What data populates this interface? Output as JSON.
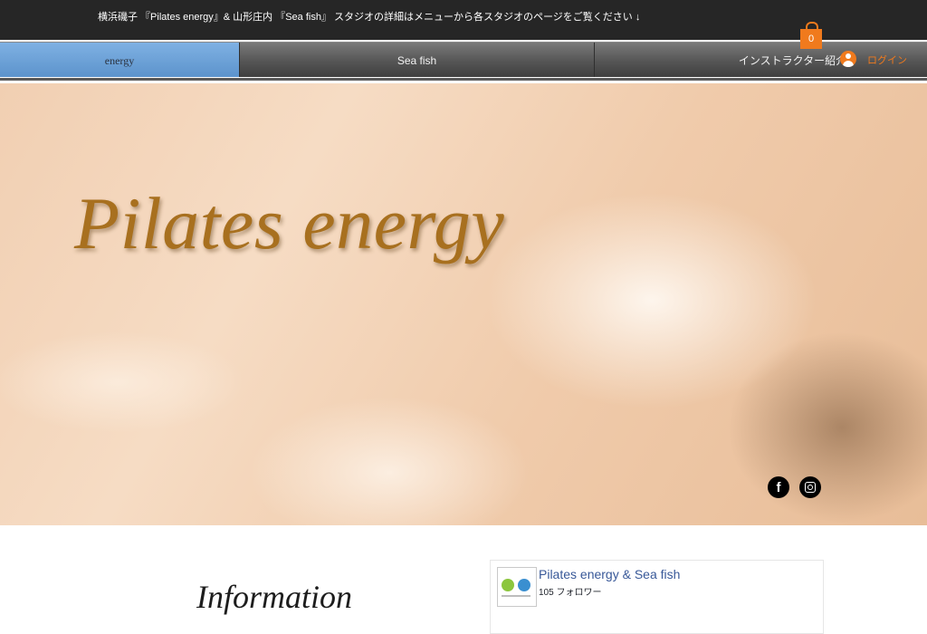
{
  "announcement": "横浜磯子 『Pilates energy』& 山形庄内 『Sea fish』 スタジオの詳細はメニューから各スタジオのページをご覧ください ↓",
  "cart": {
    "count": "0",
    "icon": "shopping-bag-icon",
    "color": "#f07a1d"
  },
  "nav": {
    "items": [
      {
        "label": "energy",
        "active": true
      },
      {
        "label": "Sea fish",
        "active": false
      },
      {
        "label": "インストラクター紹介",
        "active": false
      }
    ]
  },
  "login": {
    "label": "ログイン",
    "icon": "user-avatar-icon"
  },
  "hero": {
    "title": "Pilates energy"
  },
  "social": {
    "facebook_icon": "facebook-icon",
    "instagram_icon": "instagram-icon"
  },
  "info": {
    "title": "Information"
  },
  "facebook_widget": {
    "page_name": "Pilates energy & Sea fish",
    "followers": "105 フォロワー"
  },
  "colors": {
    "accent": "#f07a1d",
    "nav_active": "#6fa2d8",
    "title_gold": "#a8701f",
    "topbar": "#262626"
  }
}
